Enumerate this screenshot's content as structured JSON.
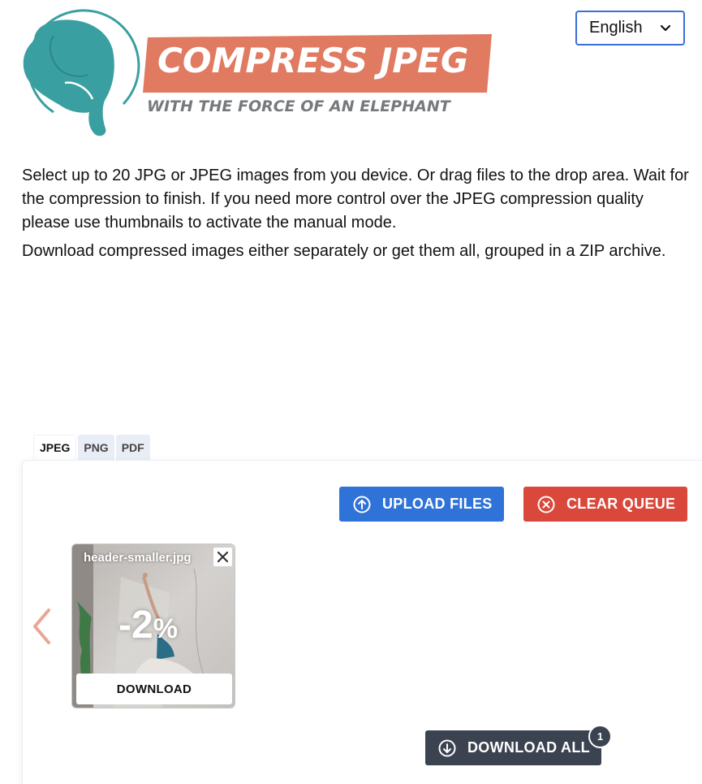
{
  "logo": {
    "title": "COMPRESS JPEG",
    "subtitle": "WITH THE FORCE OF AN ELEPHANT"
  },
  "language": {
    "selected": "English"
  },
  "intro": {
    "paragraph1": "Select up to 20 JPG or JPEG images from you device. Or drag files to the drop area. Wait for the compression to finish. If you need more control over the JPEG compression quality please use thumbnails to activate the manual mode.",
    "paragraph2": "Download compressed images either separately or get them all, grouped in a ZIP archive."
  },
  "tabs": [
    {
      "label": "JPEG",
      "active": true
    },
    {
      "label": "PNG",
      "active": false
    },
    {
      "label": "PDF",
      "active": false
    }
  ],
  "toolbar": {
    "upload_label": "UPLOAD FILES",
    "clear_label": "CLEAR QUEUE"
  },
  "queue": {
    "items": [
      {
        "filename": "header-smaller.jpg",
        "reduction": "-2",
        "reduction_unit": "%",
        "download_label": "DOWNLOAD"
      }
    ]
  },
  "download_all": {
    "label": "DOWNLOAD ALL",
    "count": "1"
  },
  "colors": {
    "brand_teal": "#3a9fa0",
    "brand_coral": "#e07a60",
    "upload_blue": "#2f72d8",
    "clear_red": "#d9483b",
    "dark": "#3c4350"
  }
}
